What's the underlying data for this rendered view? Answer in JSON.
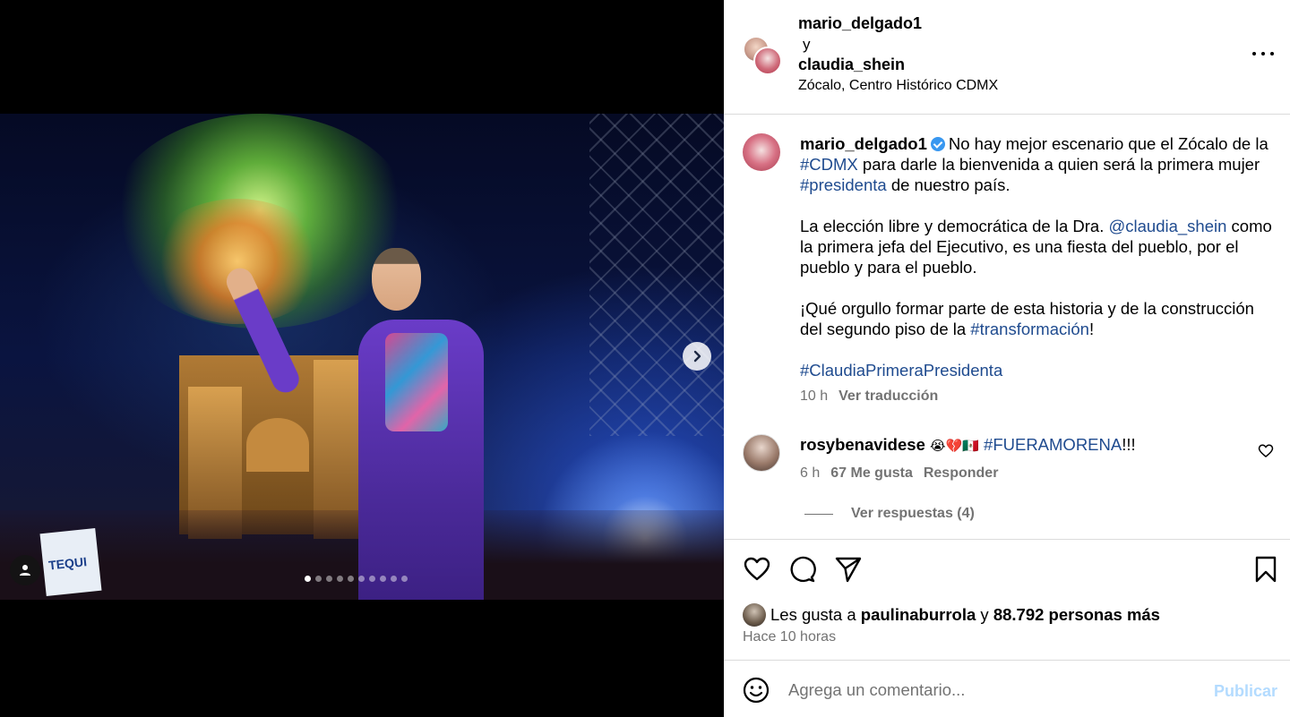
{
  "media": {
    "sign_text": "TEQUI",
    "carousel": {
      "total": 10,
      "active_index": 0
    }
  },
  "header": {
    "user1": "mario_delgado1",
    "connector": "y",
    "user2": "claudia_shein",
    "location": "Zócalo, Centro Histórico CDMX"
  },
  "caption": {
    "username": "mario_delgado1",
    "p1_a": "No hay mejor escenario que el Zócalo de la ",
    "p1_tag1": "#CDMX",
    "p1_b": " para darle la bienvenida a quien será la primera mujer ",
    "p1_tag2": "#presidenta",
    "p1_c": " de nuestro país.",
    "p2_a": "La elección libre y democrática de la Dra. ",
    "p2_mention": "@claudia_shein",
    "p2_b": " como la primera jefa del Ejecutivo, es una fiesta del pueblo, por el pueblo y para el pueblo.",
    "p3_a": "¡Qué orgullo formar parte de esta historia y de la construcción del segundo piso de la ",
    "p3_tag": "#transformación",
    "p3_b": "!",
    "p4_tag": "#ClaudiaPrimeraPresidenta",
    "age": "10 h",
    "translate": "Ver traducción"
  },
  "comment": {
    "username": "rosybenavidese",
    "emojis": "😭💔🇲🇽",
    "tag": "#FUERAMORENA",
    "suffix": "!!!",
    "age": "6 h",
    "likes": "67 Me gusta",
    "reply": "Responder",
    "view_replies": "Ver respuestas (4)"
  },
  "likes": {
    "prefix": "Les gusta a ",
    "user": "paulinaburrola",
    "middle": " y ",
    "others": "88.792 personas más",
    "time": "Hace 10 horas"
  },
  "composer": {
    "placeholder": "Agrega un comentario...",
    "publish": "Publicar"
  },
  "icons": {
    "like": "heart-icon",
    "comment": "comment-icon",
    "share": "paper-plane-icon",
    "save": "bookmark-icon",
    "emoji": "smiley-icon",
    "more": "ellipsis-icon",
    "next": "chevron-right-icon",
    "tag": "user-icon",
    "verified": "verified-badge-icon"
  },
  "colors": {
    "link": "#1f4b8f",
    "verified": "#3897f0",
    "publish_disabled": "#b3dbff",
    "secondary_text": "#737373"
  }
}
